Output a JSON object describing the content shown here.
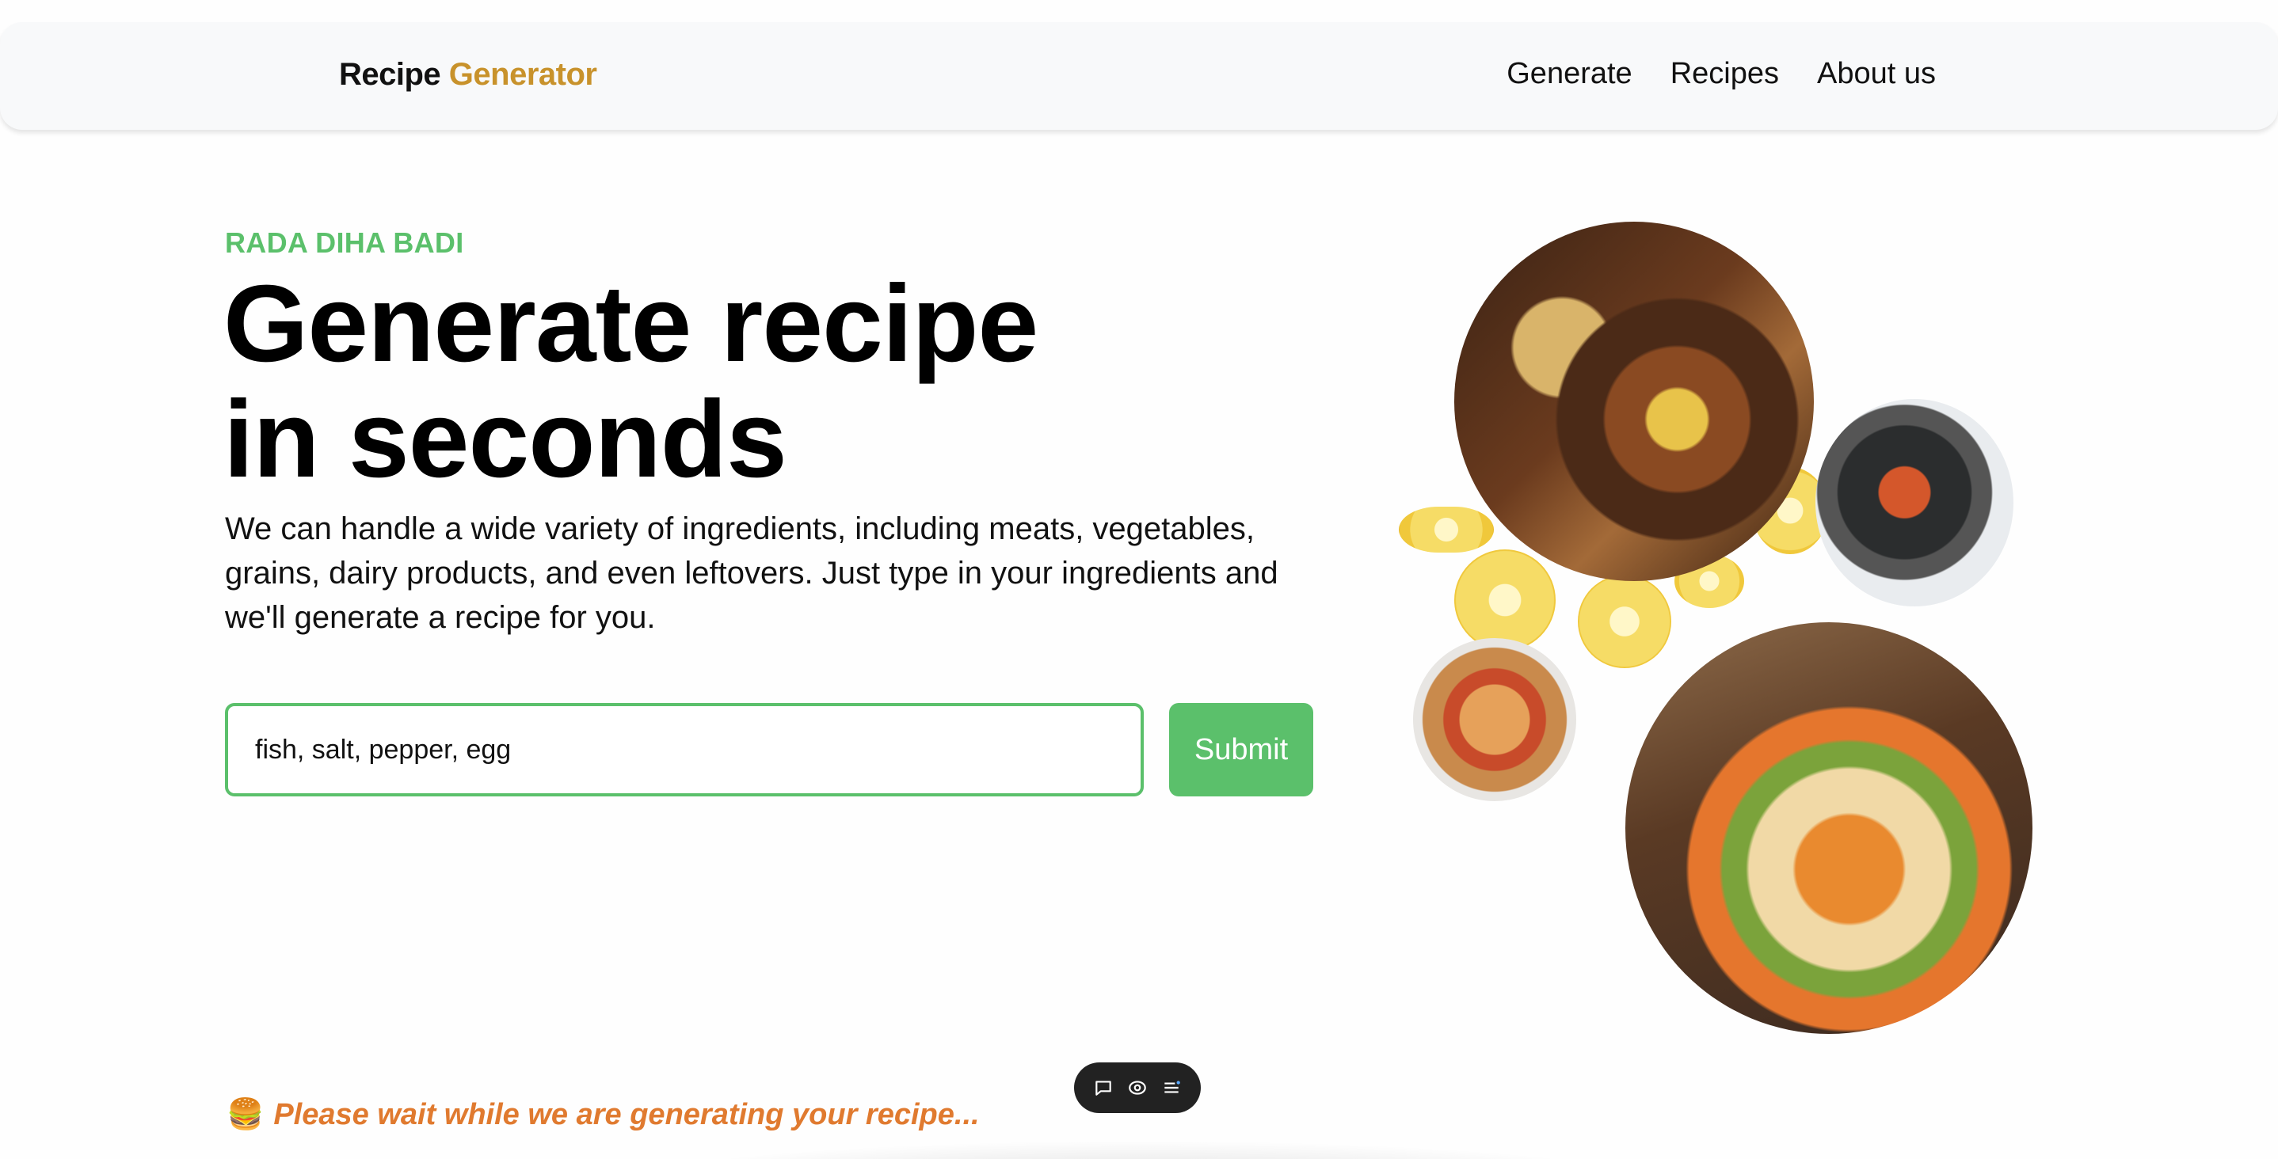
{
  "header": {
    "brand_main": "Recipe",
    "brand_accent": "Generator",
    "nav": [
      "Generate",
      "Recipes",
      "About us"
    ]
  },
  "hero": {
    "eyebrow": "RADA DIHA BADI",
    "title_line1": "Generate recipe",
    "title_line2": "in seconds",
    "description": "We can handle a wide variety of ingredients, including meats, vegetables, grains, dairy products, and even leftovers. Just type in your ingredients and we'll generate a recipe for you."
  },
  "form": {
    "ingredients_value": "fish, salt, pepper, egg",
    "submit_label": "Submit"
  },
  "status": {
    "emoji": "🍔",
    "message": "Please wait while we are generating your recipe..."
  },
  "toolbar": {
    "icons": [
      "comment-icon",
      "eye-icon",
      "menu-icon"
    ]
  },
  "colors": {
    "accent_green": "#5bc06b",
    "brand_gold": "#c8922b",
    "status_orange": "#e07a2f"
  }
}
